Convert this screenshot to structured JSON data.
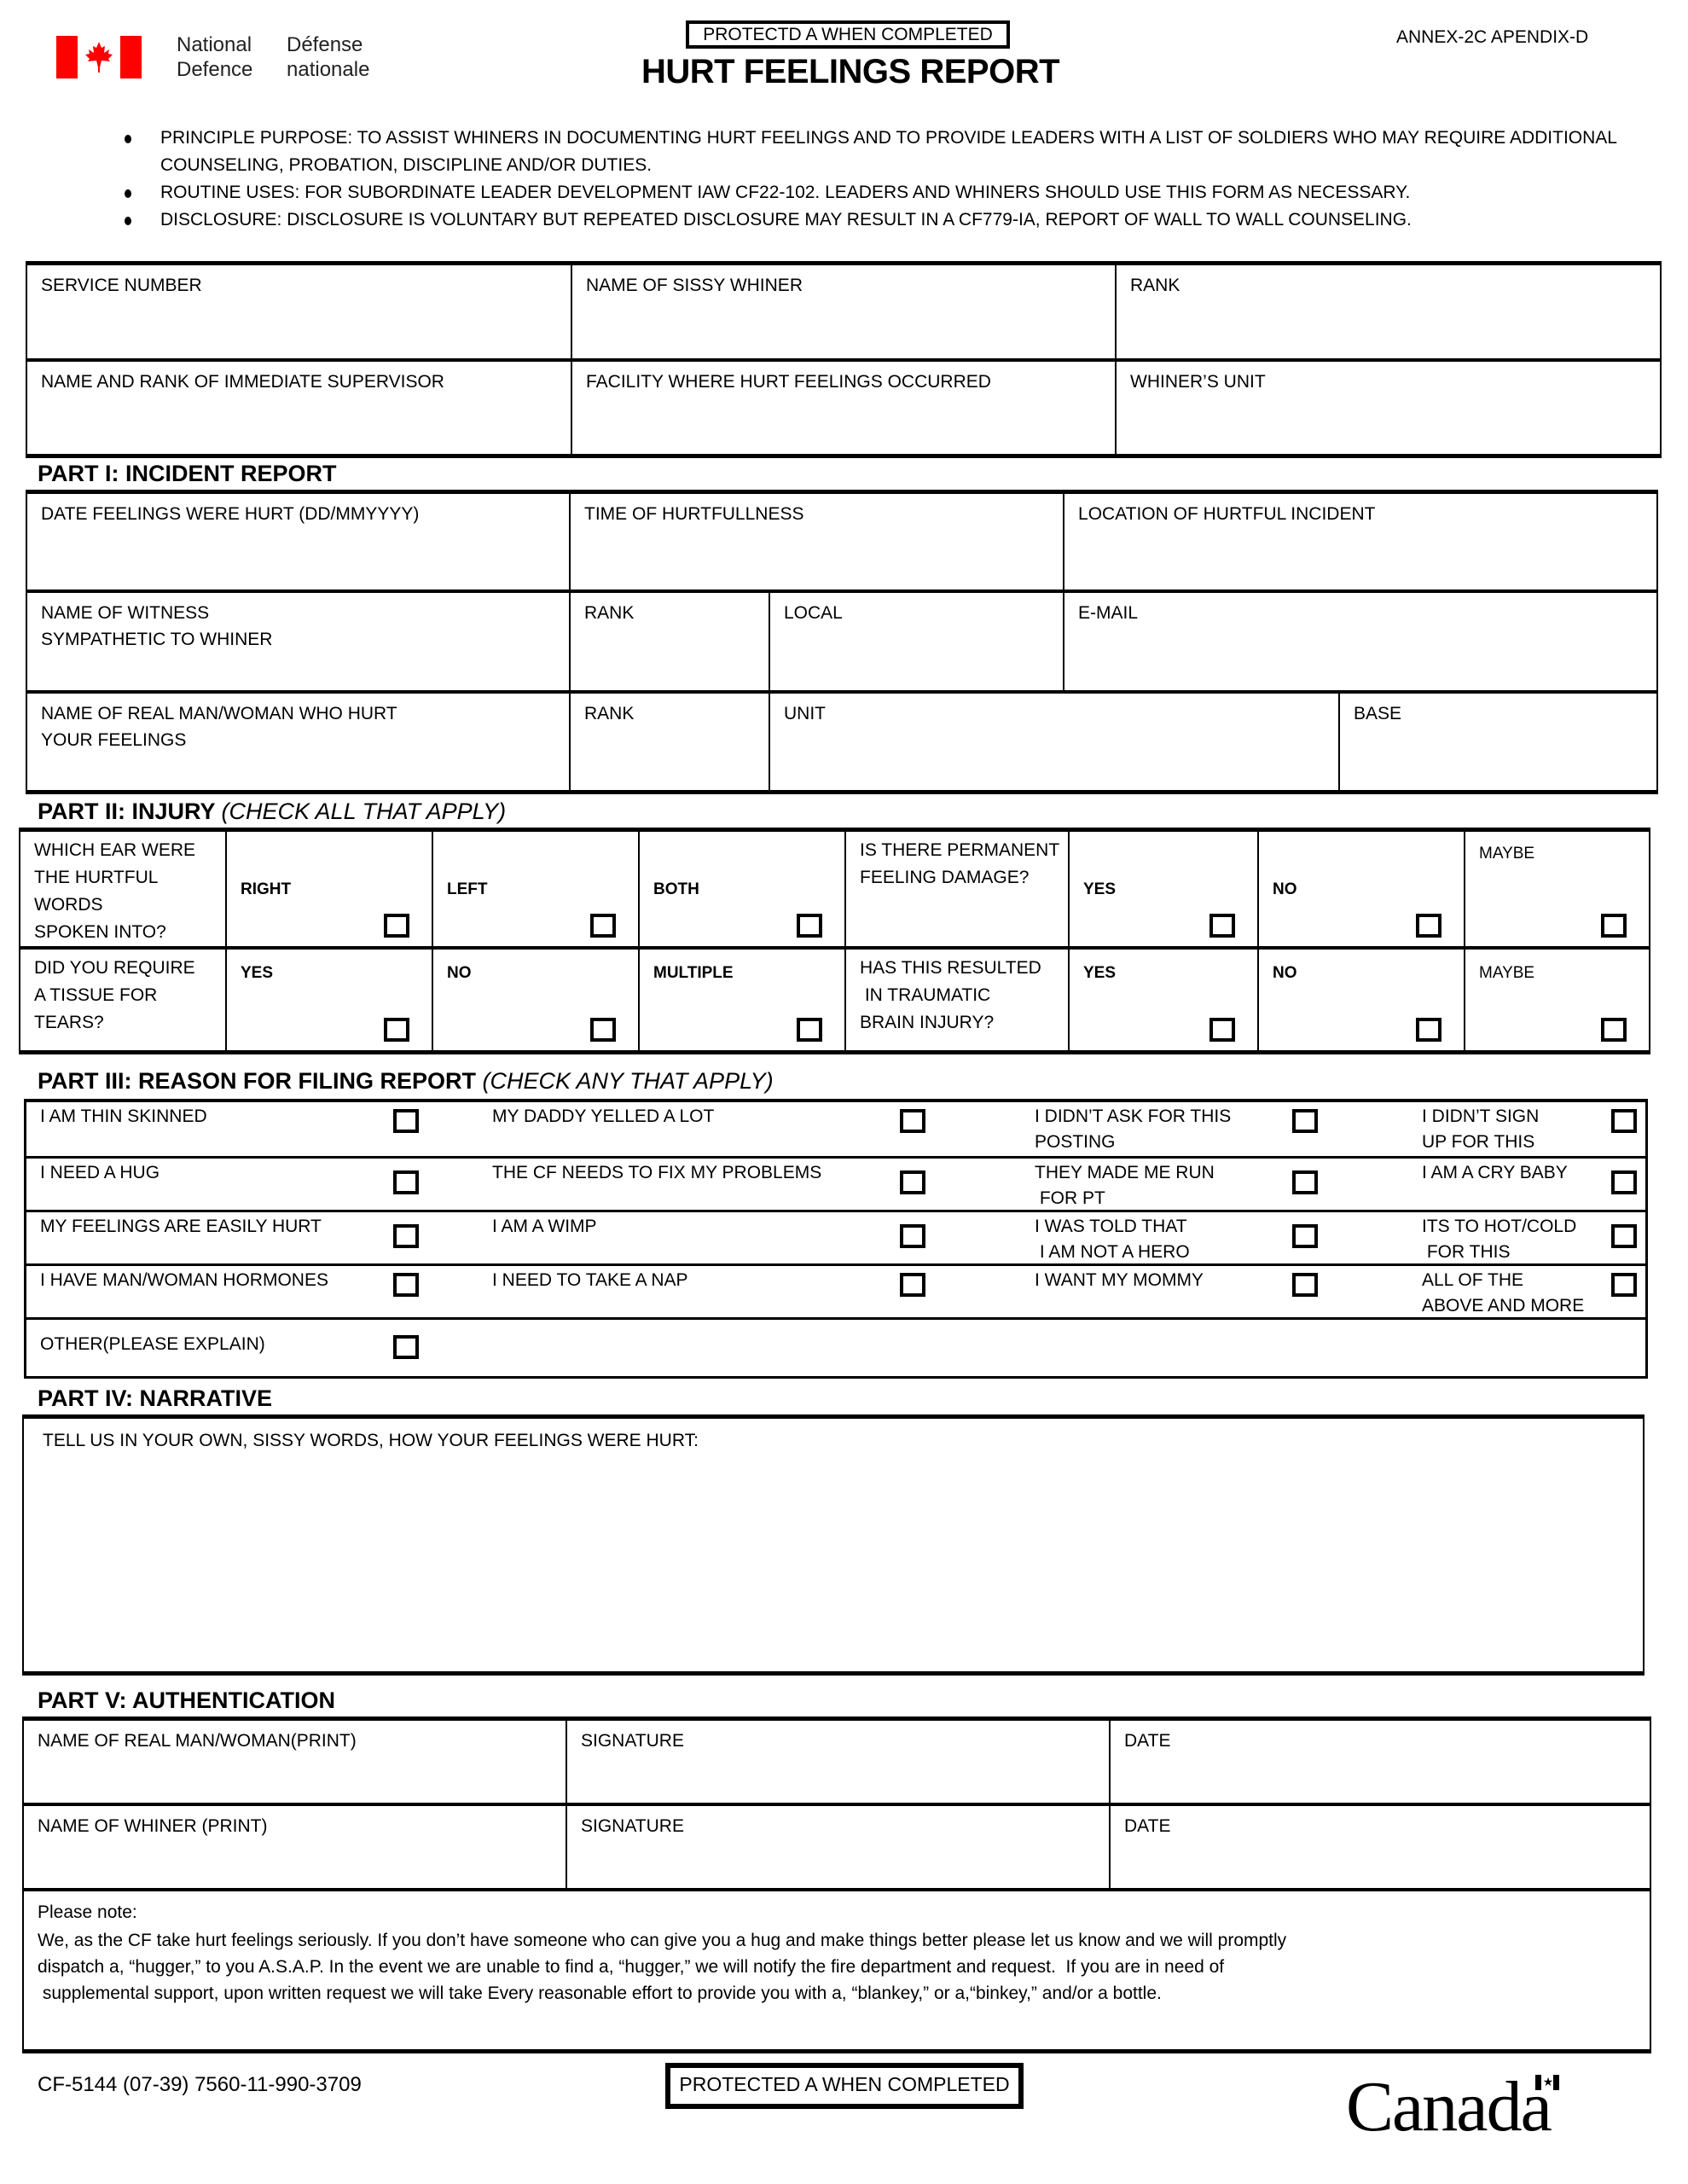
{
  "header": {
    "brand_en_line1": "National",
    "brand_en_line2": "Defence",
    "brand_fr_line1": "Défense",
    "brand_fr_line2": "nationale",
    "protected_label_top": "PROTECTD A WHEN COMPLETED",
    "title": "HURT FEELINGS REPORT",
    "annex": "ANNEX-2C APENDIX-D",
    "flag_colors": {
      "red": "#ff0000",
      "white": "#ffffff"
    }
  },
  "bullets": [
    "PRINCIPLE PURPOSE: TO ASSIST WHINERS IN DOCUMENTING HURT FEELINGS AND TO PROVIDE LEADERS WITH A LIST OF SOLDIERS WHO MAY REQUIRE ADDITIONAL COUNSELING, PROBATION, DISCIPLINE AND/OR DUTIES.",
    "ROUTINE USES: FOR SUBORDINATE LEADER DEVELOPMENT IAW CF22-102. LEADERS AND WHINERS SHOULD USE THIS FORM AS NECESSARY.",
    "DISCLOSURE: DISCLOSURE IS VOLUNTARY BUT REPEATED DISCLOSURE MAY RESULT IN A CF779-IA, REPORT OF WALL TO WALL COUNSELING."
  ],
  "identity": {
    "service_number": "SERVICE NUMBER",
    "name_whiner": "NAME OF SISSY WHINER",
    "rank": "RANK",
    "supervisor": "NAME AND RANK OF IMMEDIATE SUPERVISOR",
    "facility": "FACILITY WHERE HURT FEELINGS OCCURRED",
    "unit": "WHINER’S UNIT"
  },
  "part1": {
    "title": "PART I: INCIDENT REPORT",
    "date": "DATE FEELINGS WERE HURT (DD/MMYYYY)",
    "time": "TIME OF HURTFULLNESS",
    "location": "LOCATION OF HURTFUL INCIDENT",
    "witness_line1": "NAME OF WITNESS",
    "witness_line2": "SYMPATHETIC TO WHINER",
    "witness_rank": "RANK",
    "witness_local": "LOCAL",
    "witness_email": "E-MAIL",
    "hurter_line1": "NAME OF REAL MAN/WOMAN  WHO HURT",
    "hurter_line2": "YOUR FEELINGS",
    "hurter_rank": "RANK",
    "hurter_unit": "UNIT",
    "hurter_base": "BASE"
  },
  "part2": {
    "title": "PART II: INJURY",
    "subtitle": "(CHECK ALL THAT APPLY)",
    "q_ear": [
      "WHICH EAR WERE",
      "THE HURTFUL",
      "WORDS",
      "SPOKEN INTO?"
    ],
    "q_ear_opts": [
      "RIGHT",
      "LEFT",
      "BOTH"
    ],
    "q_tissue": [
      "DID YOU REQUIRE",
      "A TISSUE FOR",
      "TEARS?"
    ],
    "q_tissue_opts": [
      "YES",
      "NO",
      "MULTIPLE"
    ],
    "q_damage": [
      "IS THERE PERMANENT",
      "FEELING DAMAGE?"
    ],
    "q_damage_opts": [
      "YES",
      "NO",
      "MAYBE"
    ],
    "q_tbi": [
      "HAS THIS RESULTED",
      " IN TRAUMATIC",
      "BRAIN INJURY?"
    ],
    "q_tbi_opts": [
      "YES",
      "NO",
      "MAYBE"
    ]
  },
  "part3": {
    "title": "PART III: REASON FOR FILING REPORT",
    "subtitle": "(CHECK ANY THAT APPLY)",
    "rows": [
      [
        [
          "I AM THIN SKINNED"
        ],
        [
          "MY DADDY YELLED A LOT"
        ],
        [
          "I DIDN’T ASK FOR THIS",
          "POSTING"
        ],
        [
          "I DIDN’T SIGN",
          "UP FOR THIS"
        ]
      ],
      [
        [
          "I NEED A HUG"
        ],
        [
          "THE CF NEEDS TO FIX MY PROBLEMS"
        ],
        [
          "THEY MADE ME RUN",
          " FOR PT"
        ],
        [
          "I AM A CRY BABY"
        ]
      ],
      [
        [
          "MY FEELINGS ARE EASILY HURT"
        ],
        [
          "I AM A WIMP"
        ],
        [
          "I WAS TOLD THAT",
          " I AM NOT A HERO"
        ],
        [
          "ITS TO HOT/COLD",
          " FOR THIS"
        ]
      ],
      [
        [
          "I HAVE MAN/WOMAN HORMONES"
        ],
        [
          "I NEED TO TAKE A NAP"
        ],
        [
          "I WANT MY MOMMY"
        ],
        [
          "ALL OF THE",
          "ABOVE AND MORE"
        ]
      ]
    ],
    "other": "OTHER(PLEASE EXPLAIN)"
  },
  "part4": {
    "title": "PART IV: NARRATIVE",
    "prompt": "TELL US IN YOUR OWN, SISSY WORDS, HOW YOUR FEELINGS WERE HURT:"
  },
  "part5": {
    "title": "PART V: AUTHENTICATION",
    "row1": [
      "NAME OF REAL MAN/WOMAN(PRINT)",
      "SIGNATURE",
      "DATE"
    ],
    "row2": [
      "NAME OF WHINER (PRINT)",
      "SIGNATURE",
      "DATE"
    ],
    "note_heading": "Please note:",
    "note_lines": [
      "We, as the CF take hurt feelings seriously. If you don’t have someone who can give you a hug and make things better please let us know and we will promptly",
      "dispatch a, “hugger,” to you A.S.A.P. In the event we are unable to find a, “hugger,” we will notify the fire department and request.  If you are in need of",
      " supplemental support, upon written request we will take Every reasonable effort to provide you with a, “blankey,” or a,“binkey,” and/or a bottle."
    ]
  },
  "footer": {
    "form_code": "CF-5144 (07-39) 7560-11-990-3709",
    "protected_label_bottom": "PROTECTED A WHEN COMPLETED",
    "wordmark": "Canada"
  }
}
